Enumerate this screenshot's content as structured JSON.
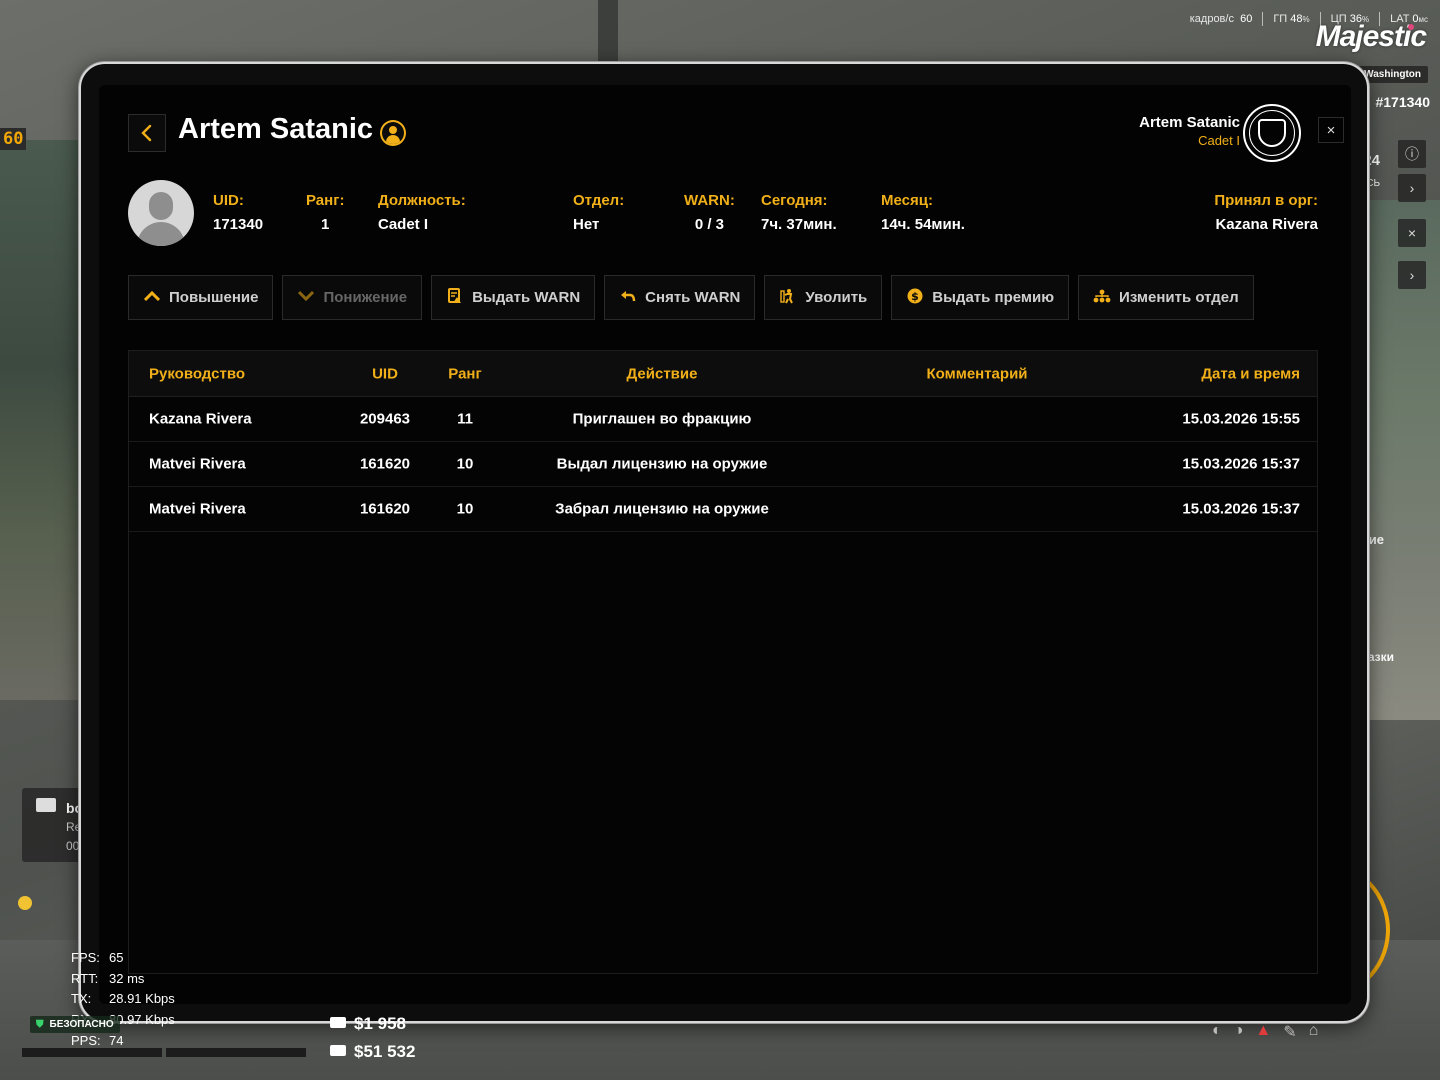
{
  "hud": {
    "fps_label": "кадров/с",
    "fps_value": "60",
    "gpu_label": "ГП",
    "gpu_value": "48",
    "gpu_unit": "%",
    "cpu_label": "ЦП",
    "cpu_value": "36",
    "cpu_unit": "%",
    "lat_label": "LAT",
    "lat_value": "0",
    "lat_unit": "мс",
    "brand": "Majestic",
    "city": "Washington",
    "player_id": "#171340",
    "side_number": "24",
    "side_small": "ОСЬ",
    "side_text1": "ие",
    "side_text2": "азки",
    "tl_number": "60",
    "cam_title": "bo",
    "cam_line1": "Re",
    "cam_line2": "00"
  },
  "netstats": [
    {
      "label": "FPS:",
      "value": "65"
    },
    {
      "label": "RTT:",
      "value": "32 ms"
    },
    {
      "label": "TX:",
      "value": "28.91 Kbps"
    },
    {
      "label": "RX:",
      "value": "80.97 Kbps"
    },
    {
      "label": "PPS:",
      "value": "74"
    }
  ],
  "safe_zone": "БЕЗОПАСНО",
  "money": {
    "cash": "$1 958",
    "bank": "$51 532"
  },
  "header": {
    "player_name": "Artem Satanic",
    "current_user_name": "Artem Satanic",
    "current_user_rank": "Cadet I",
    "close_icon": "×"
  },
  "stats": {
    "uid_label": "UID:",
    "uid_value": "171340",
    "rank_label": "Ранг:",
    "rank_value": "1",
    "position_label": "Должность:",
    "position_value": "Cadet I",
    "dept_label": "Отдел:",
    "dept_value": "Нет",
    "warn_label": "WARN:",
    "warn_value": "0 / 3",
    "today_label": "Сегодня:",
    "today_value": "7ч. 37мин.",
    "month_label": "Месяц:",
    "month_value": "14ч. 54мин.",
    "hired_by_label": "Принял в орг:",
    "hired_by_value": "Kazana Rivera"
  },
  "actions": {
    "promote": "Повышение",
    "demote": "Понижение",
    "give_warn": "Выдать WARN",
    "remove_warn": "Снять WARN",
    "fire": "Уволить",
    "give_bonus": "Выдать премию",
    "change_dept": "Изменить отдел"
  },
  "log_table": {
    "columns": {
      "leader": "Руководство",
      "uid": "UID",
      "rank": "Ранг",
      "action": "Действие",
      "comment": "Комментарий",
      "datetime": "Дата и время"
    },
    "rows": [
      {
        "leader": "Kazana Rivera",
        "uid": "209463",
        "rank": "11",
        "action": "Приглашен во фракцию",
        "comment": "",
        "datetime": "15.03.2026 15:55"
      },
      {
        "leader": "Matvei Rivera",
        "uid": "161620",
        "rank": "10",
        "action": "Выдал лицензию на оружие",
        "comment": "",
        "datetime": "15.03.2026 15:37"
      },
      {
        "leader": "Matvei Rivera",
        "uid": "161620",
        "rank": "10",
        "action": "Забрал лицензию на оружие",
        "comment": "",
        "datetime": "15.03.2026 15:37"
      }
    ]
  },
  "colors": {
    "accent": "#f1b019",
    "background": "#030303",
    "text": "#ffffff"
  }
}
